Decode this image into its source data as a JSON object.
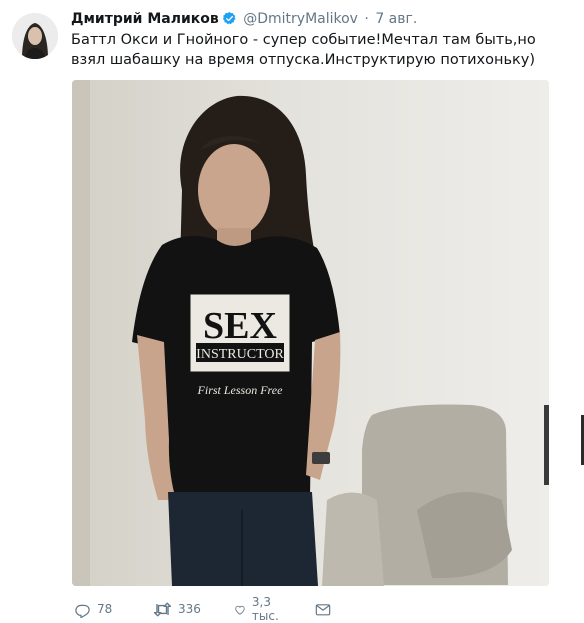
{
  "tweet": {
    "author_name": "Дмитрий Маликов",
    "author_handle": "@DmitryMalikov",
    "separator": "·",
    "date": "7 авг.",
    "text": "Баттл Окси и Гнойного - супер событие!Мечтал там быть,но взял шабашку на время отпуска.Инструктирую потихоньку)",
    "photo": {
      "shirt_title": "SEX",
      "shirt_banner": "INSTRUCTOR",
      "shirt_tagline": "First Lesson Free"
    },
    "actions": {
      "replies": "78",
      "retweets": "336",
      "likes": "3,3 тыс."
    }
  },
  "icons": [
    "verified-badge-icon",
    "reply-icon",
    "retweet-icon",
    "like-icon",
    "message-icon"
  ],
  "colors": {
    "verified": "#1da1f2",
    "meta": "#657786",
    "text": "#14171a"
  }
}
